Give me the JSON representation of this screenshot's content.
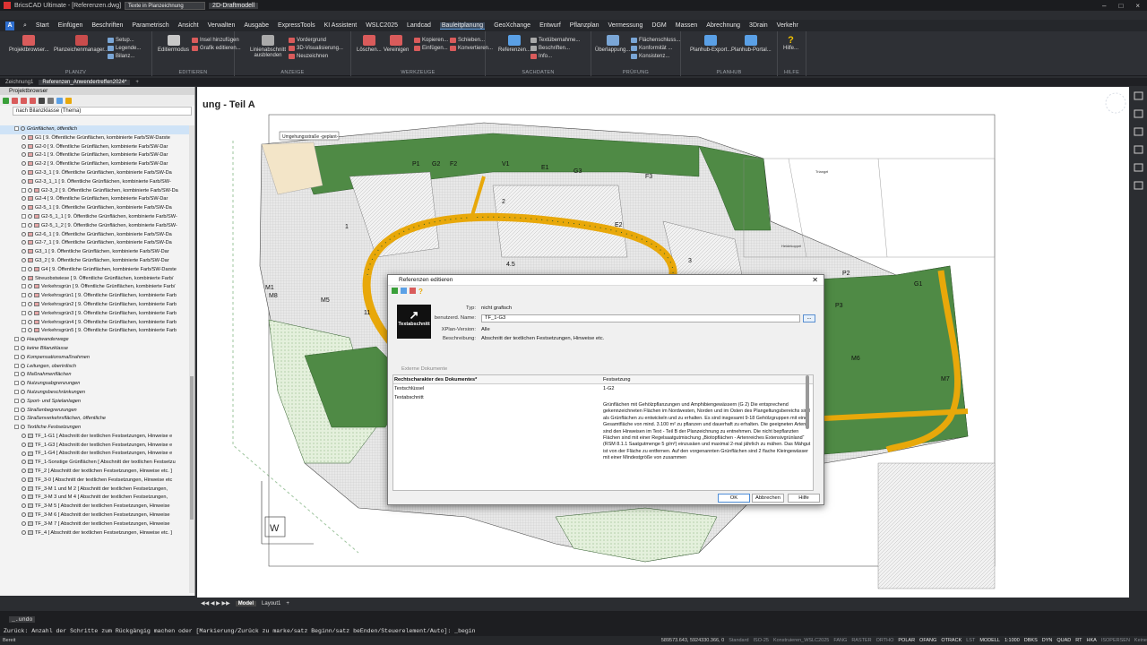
{
  "app": {
    "title": "BricsCAD Ultimate - [Referenzen.dwg]",
    "quick_search": "Texte in Planzeichnung",
    "workspace": "2D-Draftmodell"
  },
  "menu": {
    "tabs": [
      "Start",
      "Einfügen",
      "Beschriften",
      "Parametrisch",
      "Ansicht",
      "Verwalten",
      "Ausgabe",
      "ExpressTools",
      "KI Assistent",
      "WSLC2025",
      "Landcad",
      "Bauleitplanung",
      "GeoXchange",
      "Entwurf",
      "Pflanzplan",
      "Vermessung",
      "DGM",
      "Massen",
      "Abrechnung",
      "3Drain",
      "Verkehr"
    ],
    "active": "Bauleitplanung"
  },
  "ribbon": {
    "groups": {
      "planzv": "PLANZV",
      "editieren": "EDITIEREN",
      "anzeige": "ANZEIGE",
      "werkzeuge": "WERKZEUGE",
      "sachdaten": "SACHDATEN",
      "pruefung": "PRÜFUNG",
      "planhub": "PLANHUB",
      "hilfe": "HILFE"
    },
    "buttons": {
      "projektbrowser": "Projektbrowser...",
      "planzeichenmanager": "Planzeichenmanager...",
      "setup": "Setup...",
      "legende": "Legende...",
      "bilanz": "Bilanz...",
      "editiermodus": "Editiermodus",
      "insel": "Insel hinzufügen",
      "grafik": "Grafik editieren...",
      "linienabschnitt": "Linienabschnitt ausblenden",
      "vordergrund": "Vordergrund",
      "visualisierung": "3D-Visualisierung...",
      "neuzeichnen": "Neuzeichnen",
      "loeschen": "Löschen...",
      "vereinigen": "Vereinigen",
      "kopieren": "Kopieren...",
      "einfuegen": "Einfügen...",
      "schieben": "Schieben...",
      "konvertieren": "Konvertieren...",
      "referenzen": "Referenzen...",
      "textuebernahme": "Textübernahme...",
      "beschriften": "Beschriften...",
      "info": "Info...",
      "ueberlappung": "Überlappung...",
      "flaechenschluss": "Flächenschluss...",
      "konformitaet": "Konformität ...",
      "konsistenz": "Konsistenz...",
      "planhub_export": "Planhub-Export...",
      "planhub_portal": "Planhub-Portal...",
      "hilfe": "Hilfe..."
    }
  },
  "doctabs": [
    "Zeichnung1",
    "Referenzen_Anwendertreffen2024*",
    "+"
  ],
  "panel": {
    "title": "Projektbrowser",
    "filter": "nach Bilanzklasse (Thema)",
    "items": [
      {
        "t": "Grünflächen, öffentlich",
        "g": true,
        "lvl": 0,
        "sel": true
      },
      {
        "t": "G1 [ 9. Öffentliche Grünflächen, kombinierte Farb/SW-Darste",
        "lvl": 1,
        "c": "#e7a6a6"
      },
      {
        "t": "G2-0 [ 9. Öffentliche Grünflächen, kombinierte Farb/SW-Dar",
        "lvl": 1,
        "c": "#e7a6a6"
      },
      {
        "t": "G2-1 [ 9. Öffentliche Grünflächen, kombinierte Farb/SW-Dar",
        "lvl": 1,
        "c": "#e7a6a6"
      },
      {
        "t": "G2-2 [ 9. Öffentliche Grünflächen, kombinierte Farb/SW-Dar",
        "lvl": 1,
        "c": "#e7a6a6"
      },
      {
        "t": "G2-3_1 [ 9. Öffentliche Grünflächen, kombinierte Farb/SW-Da",
        "lvl": 1,
        "c": "#e7a6a6"
      },
      {
        "t": "G2-3_1_1 [ 9. Öffentliche Grünflächen, kombinierte Farb/SW-",
        "lvl": 1,
        "c": "#e7a6a6"
      },
      {
        "t": "G2-3_2 [ 9. Öffentliche Grünflächen, kombinierte Farb/SW-Da",
        "lvl": 1,
        "c": "#e7a6a6",
        "e": true
      },
      {
        "t": "G2-4 [ 9. Öffentliche Grünflächen, kombinierte Farb/SW-Dar",
        "lvl": 1,
        "c": "#e7a6a6"
      },
      {
        "t": "G2-5_1 [ 9. Öffentliche Grünflächen, kombinierte Farb/SW-Da",
        "lvl": 1,
        "c": "#e7a6a6"
      },
      {
        "t": "G2-5_1_1 [ 9. Öffentliche Grünflächen, kombinierte Farb/SW-",
        "lvl": 1,
        "c": "#e7a6a6",
        "e": true
      },
      {
        "t": "G2-5_1_2 [ 9. Öffentliche Grünflächen, kombinierte Farb/SW-",
        "lvl": 1,
        "c": "#e7a6a6",
        "e": true
      },
      {
        "t": "G2-6_1 [ 9. Öffentliche Grünflächen, kombinierte Farb/SW-Da",
        "lvl": 1,
        "c": "#e7a6a6"
      },
      {
        "t": "G2-7_1 [ 9. Öffentliche Grünflächen, kombinierte Farb/SW-Da",
        "lvl": 1,
        "c": "#e7a6a6"
      },
      {
        "t": "G3_1 [ 9. Öffentliche Grünflächen, kombinierte Farb/SW-Dar",
        "lvl": 1,
        "c": "#e7a6a6"
      },
      {
        "t": "G3_2 [ 9. Öffentliche Grünflächen, kombinierte Farb/SW-Dar",
        "lvl": 1,
        "c": "#e7a6a6"
      },
      {
        "t": "G4 [ 9. Öffentliche Grünflächen, kombinierte Farb/SW-Darste",
        "lvl": 1,
        "c": "#e7a6a6",
        "e": true
      },
      {
        "t": "Streuobstwiese [ 9. Öffentliche Grünflächen, kombinierte Farb/",
        "lvl": 1,
        "c": "#e7a6a6"
      },
      {
        "t": "Verkehrsgrün [ 9. Öffentliche Grünflächen, kombinierte Farb/",
        "lvl": 1,
        "c": "#e7a6a6",
        "e": true
      },
      {
        "t": "Verkehrsgrün1 [ 9. Öffentliche Grünflächen, kombinierte Farb",
        "lvl": 1,
        "c": "#e7a6a6",
        "e": true
      },
      {
        "t": "Verkehrsgrün2 [ 9. Öffentliche Grünflächen, kombinierte Farb",
        "lvl": 1,
        "c": "#e7a6a6",
        "e": true
      },
      {
        "t": "Verkehrsgrün3 [ 9. Öffentliche Grünflächen, kombinierte Farb",
        "lvl": 1,
        "c": "#e7a6a6",
        "e": true
      },
      {
        "t": "Verkehrsgrün4 [ 9. Öffentliche Grünflächen, kombinierte Farb",
        "lvl": 1,
        "c": "#e7a6a6",
        "e": true
      },
      {
        "t": "Verkehrsgrün5 [ 9. Öffentliche Grünflächen, kombinierte Farb",
        "lvl": 1,
        "c": "#e7a6a6",
        "e": true
      },
      {
        "t": "Hauptwanderwege",
        "g": true,
        "lvl": 0
      },
      {
        "t": "keine Bilanzklasse",
        "g": true,
        "lvl": 0
      },
      {
        "t": "Kompensationsmaßnahmen",
        "g": true,
        "lvl": 0
      },
      {
        "t": "Leitungen, oberirdisch",
        "g": true,
        "lvl": 0
      },
      {
        "t": "Maßnahmenflächen",
        "g": true,
        "lvl": 0
      },
      {
        "t": "Nutzungsabgrenzungen",
        "g": true,
        "lvl": 0
      },
      {
        "t": "Nutzungsbeschränkungen",
        "g": true,
        "lvl": 0
      },
      {
        "t": "Sport- und Spielanlagen",
        "g": true,
        "lvl": 0
      },
      {
        "t": "Straßenbegrenzungen",
        "g": true,
        "lvl": 0
      },
      {
        "t": "Straßenverkehrsflächen, öffentliche",
        "g": true,
        "lvl": 0
      },
      {
        "t": "Textliche Festsetzungen",
        "g": true,
        "lvl": 0
      },
      {
        "t": "TF_1-G1 [ Abschnitt der textlichen Festsetzungen, Hinweise e",
        "lvl": 1,
        "c": "#cccccc"
      },
      {
        "t": "TF_1-G3 [ Abschnitt der textlichen Festsetzungen, Hinweise e",
        "lvl": 1,
        "c": "#cccccc"
      },
      {
        "t": "TF_1-G4 [ Abschnitt der textlichen Festsetzungen, Hinweise e",
        "lvl": 1,
        "c": "#cccccc"
      },
      {
        "t": "TF_1-Sonstige Grünflächen [ Abschnitt der textlichen Festsetzu",
        "lvl": 1,
        "c": "#cccccc"
      },
      {
        "t": "TF_2 [ Abschnitt der textlichen Festsetzungen, Hinweise etc. ]",
        "lvl": 1,
        "c": "#cccccc"
      },
      {
        "t": "TF_3-0 [ Abschnitt der textlichen Festsetzungen, Hinweise etc",
        "lvl": 1,
        "c": "#cccccc"
      },
      {
        "t": "TF_3-M 1 und M 2 [ Abschnitt der textlichen Festsetzungen,",
        "lvl": 1,
        "c": "#cccccc"
      },
      {
        "t": "TF_3-M 3 und M 4 [ Abschnitt der textlichen Festsetzungen,",
        "lvl": 1,
        "c": "#cccccc"
      },
      {
        "t": "TF_3-M 5 [ Abschnitt der textlichen Festsetzungen, Hinweise",
        "lvl": 1,
        "c": "#cccccc"
      },
      {
        "t": "TF_3-M 6 [ Abschnitt der textlichen Festsetzungen, Hinweise",
        "lvl": 1,
        "c": "#cccccc"
      },
      {
        "t": "TF_3-M 7 [ Abschnitt der textlichen Festsetzungen, Hinweise",
        "lvl": 1,
        "c": "#cccccc"
      },
      {
        "t": "TF_4 [ Abschnitt der textlichen Festsetzungen, Hinweise etc. ]",
        "lvl": 1,
        "c": "#cccccc"
      }
    ]
  },
  "drawing": {
    "title": "ung - Teil A",
    "street_label": "Umgehungsstraße -geplant-",
    "labels": [
      "Triangel",
      "Heidekoppel",
      "1",
      "2",
      "3",
      "4.5",
      "11",
      "M1",
      "M5",
      "M6",
      "M7",
      "M8",
      "P1",
      "P2",
      "P3",
      "G2",
      "G3",
      "E1",
      "E2",
      "F2",
      "F3",
      "G1",
      "V1"
    ],
    "axis": "W"
  },
  "dialog": {
    "title": "Referenzen editieren",
    "icon_caption": "Textabschnitt",
    "fields": {
      "typ_label": "Typ:",
      "typ_value": "nicht grafisch",
      "name_label": "benutzerd. Name:",
      "name_value": "TF_1-G3",
      "xplan_label": "XPlan-Version:",
      "xplan_value": "Alle",
      "beschr_label": "Beschreibung:",
      "beschr_value": "Abschnitt der textlichen Festsetzungen, Hinweise etc."
    },
    "more_button": "...",
    "section": "Externe Dokumente",
    "grid": {
      "col1_header": "Rechtscharakter des Dokumentes*",
      "col1_value": "Festsetzung",
      "row2_label": "Textschlüssel",
      "row2_value": "1-G2",
      "row3_label": "Textabschnitt",
      "text": "Grünflächen mit Gehölzpflanzungen und Amphibiengewässern (G 2) Die entsprechend gekennzeichneten Flächen im Nordwesten, Norden und im Osten des Plangeltungsbereichs sind als Grünflächen zu entwickeln und zu erhalten. Es sind insgesamt 9-18 Gehölzgruppen mit einer Gesamtfläche von mind. 3.100 m² zu pflanzen und dauerhaft zu erhalten. Die geeigneten Arten sind den Hinweisen im Text - Teil B der Planzeichnung zu entnehmen. Die nicht bepflanzten Flächen sind mit einer Regelsaatgutmischung „Biotopflächen - Artenreiches Extensivgrünland“ (RSM 8.1.1 Saatgutmenge 5 g/m²) einzusäen und maximal 2-mal jährlich zu mähen. Das Mähgut ist von der Fläche zu entfernen. Auf den vorgenannten Grünflächen sind 2 flache Kleingewässer mit einer Mindestgröße von zusammen"
    },
    "buttons": {
      "ok": "OK",
      "cancel": "Abbrechen",
      "help": "Hilfe"
    }
  },
  "layout_tabs": [
    "Model",
    "Layout1",
    "+"
  ],
  "command": {
    "history": "_.undo",
    "prompt": "Zurück: Anzahl der Schritte zum Rückgängig machen oder [Markierung/Zurück zu marke/satz Beginn/satz beEnden/Steuerelement/Auto]: _begin"
  },
  "status": {
    "left": "Bereit",
    "coords": "589573.643, 5924330.366, 0",
    "items": [
      "Standard",
      "ISO-25",
      "Konstruieren_WSLC2025",
      "FANG",
      "RASTER",
      "ORTHO",
      "POLAR",
      "OFANG",
      "OTRACK",
      "LST",
      "MODELL",
      "1:1000",
      "DBKS",
      "DYN",
      "QUAD",
      "RT",
      "HKA",
      "ISOPERSEN",
      "Keine"
    ],
    "on": [
      "POLAR",
      "OFANG",
      "OTRACK",
      "MODELL",
      "1:1000",
      "DBKS",
      "DYN",
      "QUAD",
      "RT",
      "HKA"
    ]
  },
  "colors": {
    "green_dark": "#4f8a45",
    "green_light": "#9ecb7e",
    "road": "#e8a80a",
    "accent": "#2f6fcf"
  }
}
